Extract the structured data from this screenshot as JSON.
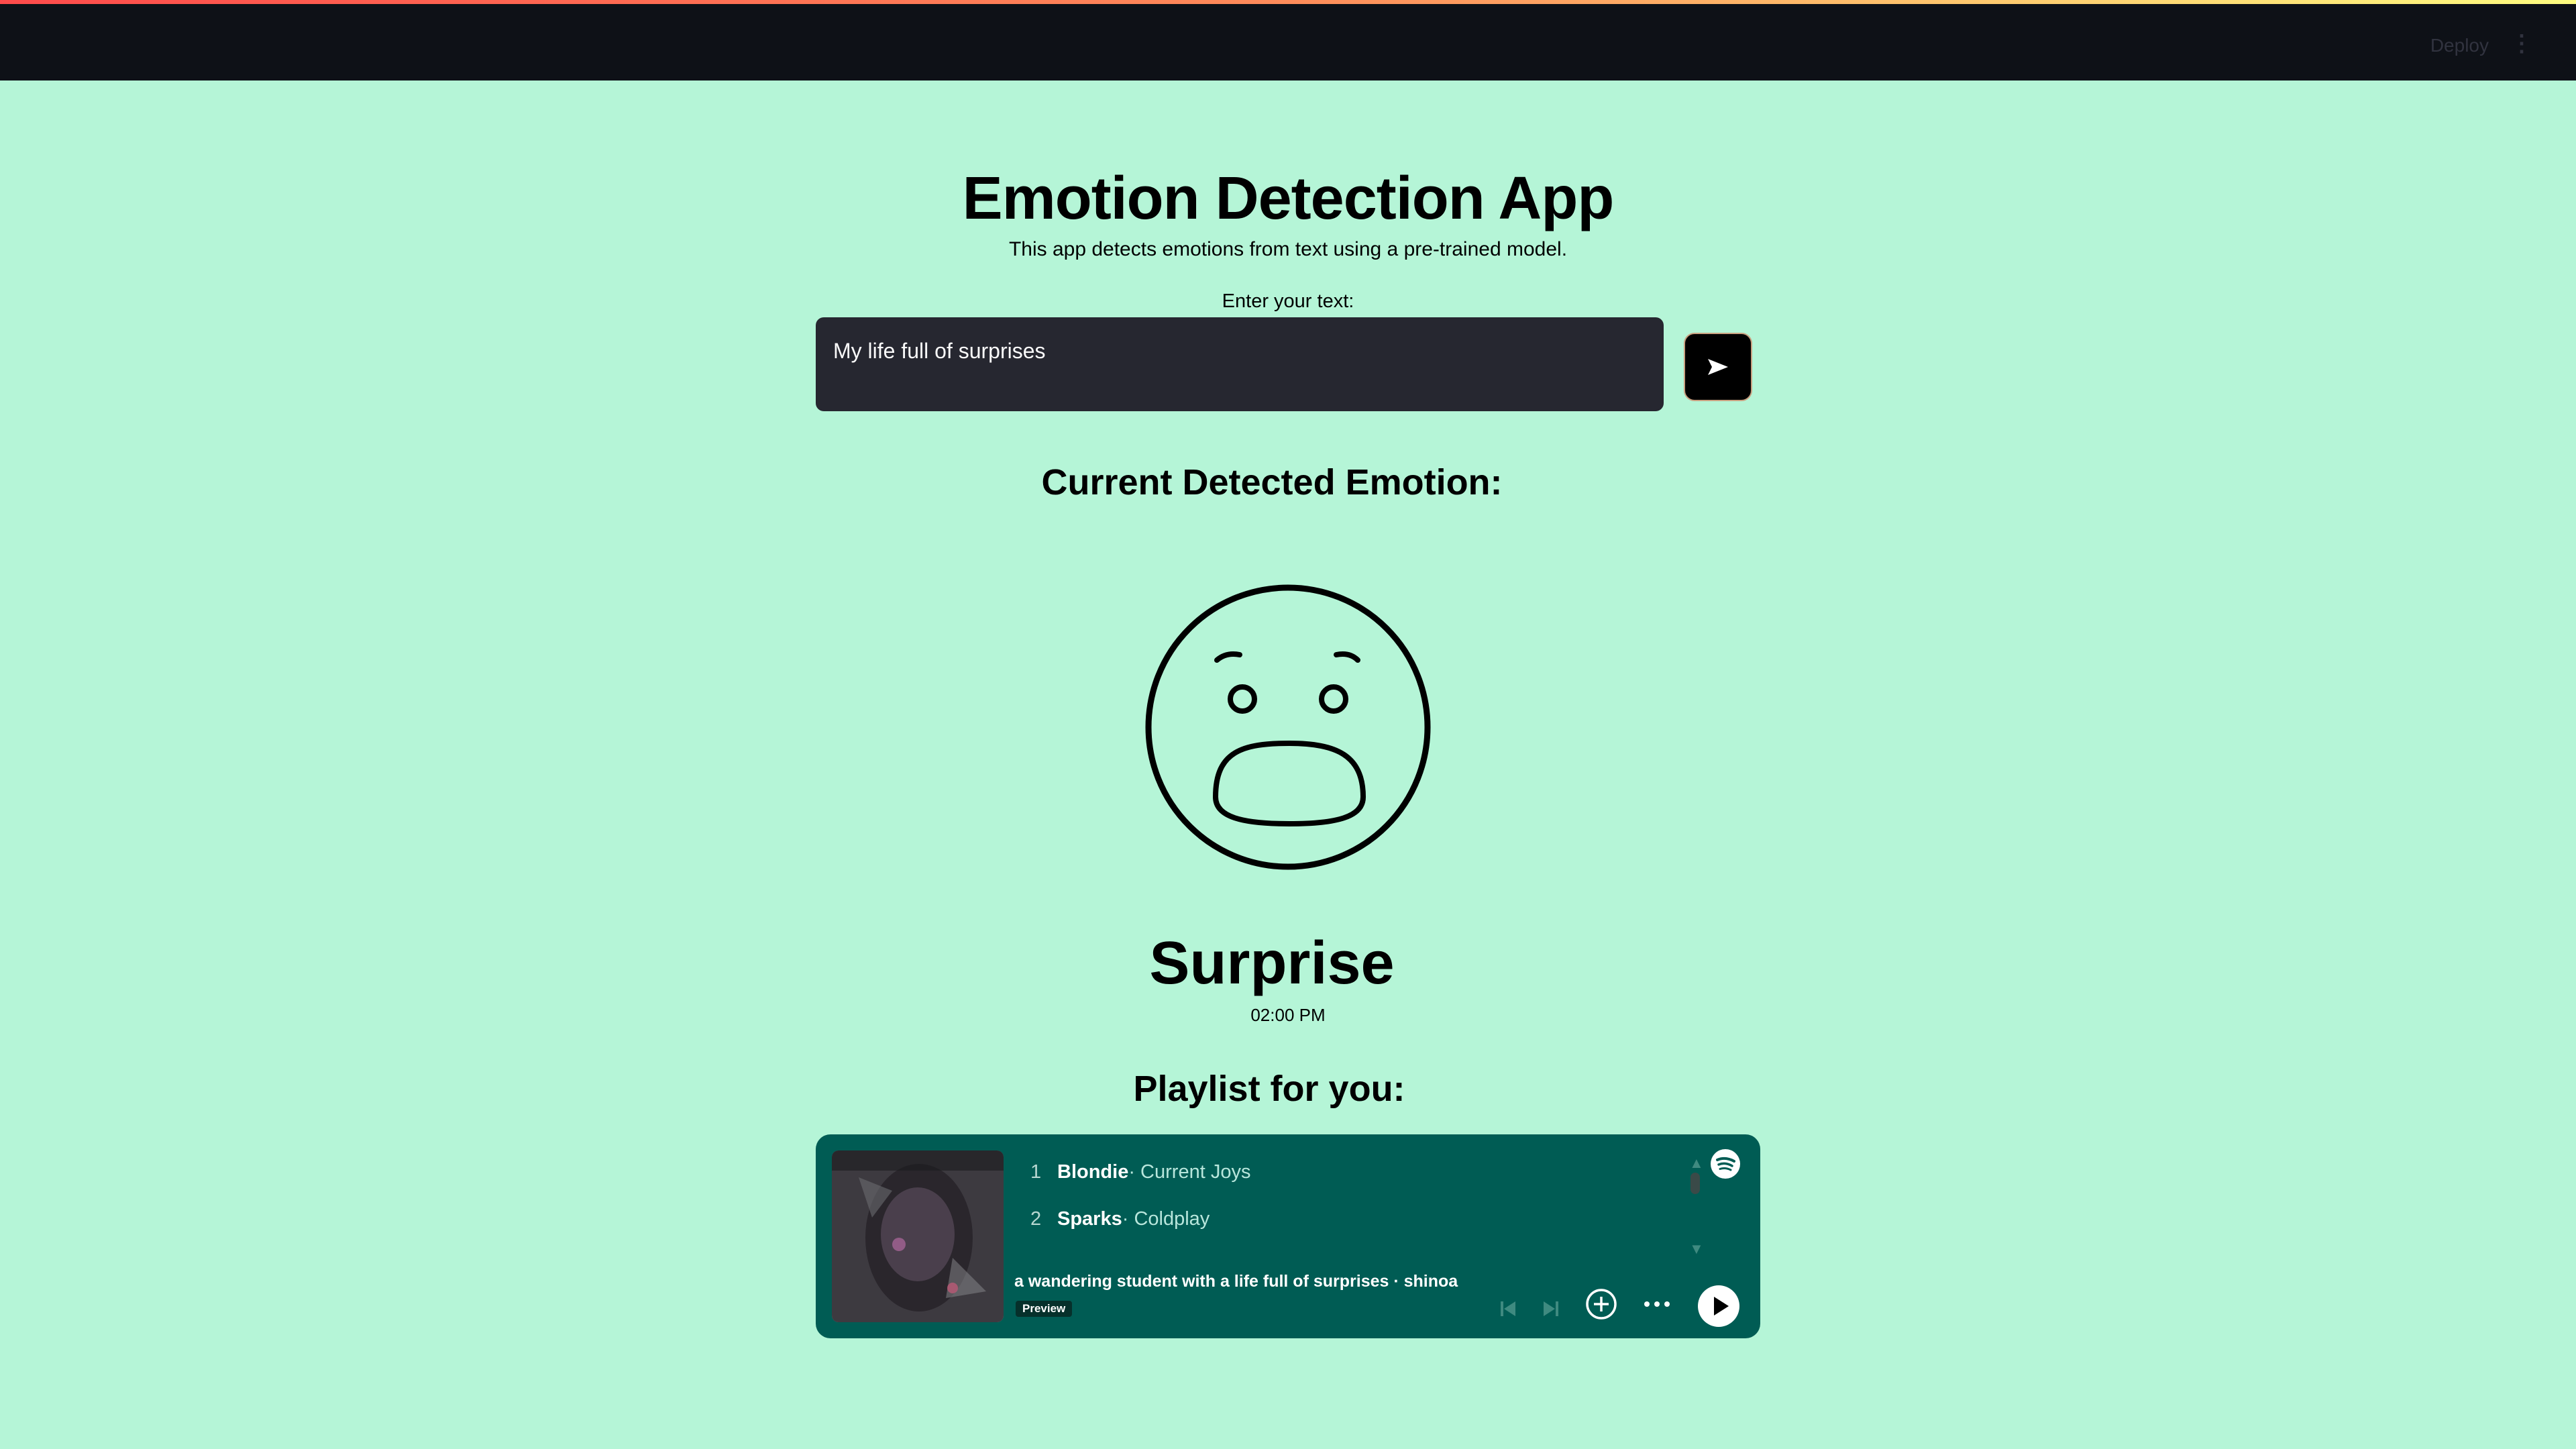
{
  "header": {
    "deploy_label": "Deploy",
    "menu_icon": "vertical-ellipsis-icon"
  },
  "main": {
    "title": "Emotion Detection App",
    "subtitle": "This app detects emotions from text using a pre-trained model.",
    "input_label": "Enter your text:",
    "input_value": "My life full of surprises",
    "send_icon": "send-arrow-icon",
    "emotion_heading": "Current Detected Emotion:",
    "emotion_icon": "surprised-face-icon",
    "emotion": "Surprise",
    "time": "02:00 PM",
    "playlist_heading": "Playlist for you:"
  },
  "player": {
    "tracks": [
      {
        "num": "1",
        "song": "Blondie",
        "artist": " · Current Joys"
      },
      {
        "num": "2",
        "song": "Sparks",
        "artist": " · Coldplay"
      }
    ],
    "description": "a wandering student with a life full of surprises · shinoa",
    "preview_label": "Preview",
    "accent_color": "#005c54"
  }
}
